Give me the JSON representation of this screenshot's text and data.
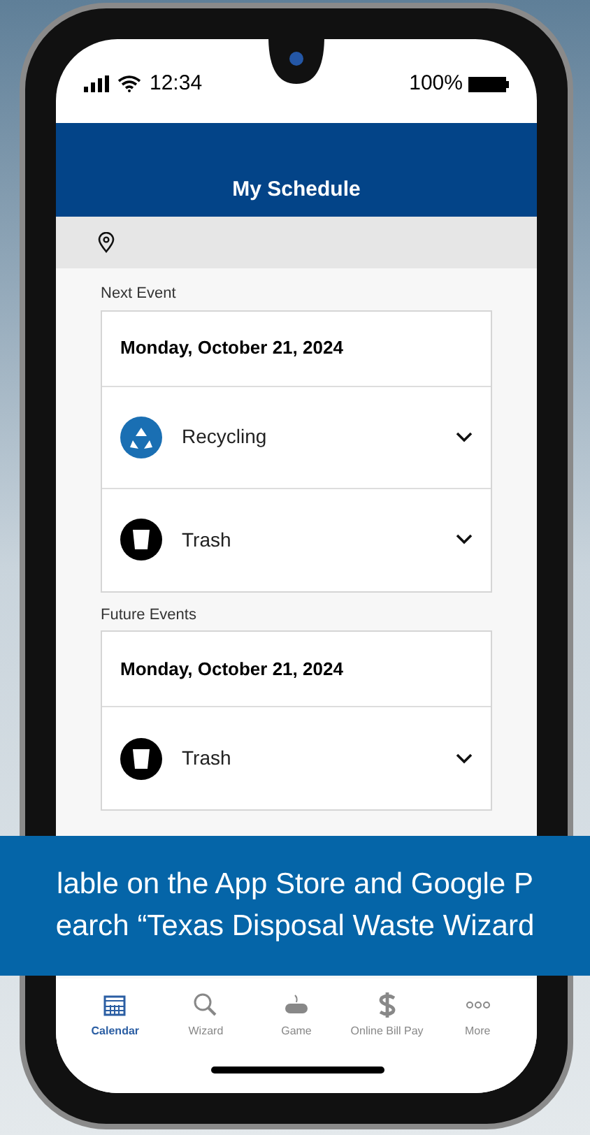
{
  "status_bar": {
    "time": "12:34",
    "battery": "100%"
  },
  "header": {
    "title": "My Schedule"
  },
  "sections": [
    {
      "label": "Next Event",
      "date": "Monday, October 21, 2024",
      "items": [
        {
          "kind": "recycling",
          "name": "Recycling"
        },
        {
          "kind": "trash",
          "name": "Trash"
        }
      ]
    },
    {
      "label": "Future Events",
      "date": "Monday, October 21, 2024",
      "items": [
        {
          "kind": "trash",
          "name": "Trash"
        }
      ]
    }
  ],
  "banner": {
    "lines": [
      "lable on the App Store and Google P",
      "earch “Texas Disposal Waste Wizard"
    ]
  },
  "tab_bar": [
    {
      "kind": "calendar",
      "label": "Calendar",
      "selected": true
    },
    {
      "kind": "wizard",
      "label": "Wizard",
      "selected": false
    },
    {
      "kind": "game",
      "label": "Game",
      "selected": false
    },
    {
      "kind": "pay",
      "label": "Online Bill Pay",
      "selected": false
    },
    {
      "kind": "more",
      "label": "More",
      "selected": false
    }
  ]
}
